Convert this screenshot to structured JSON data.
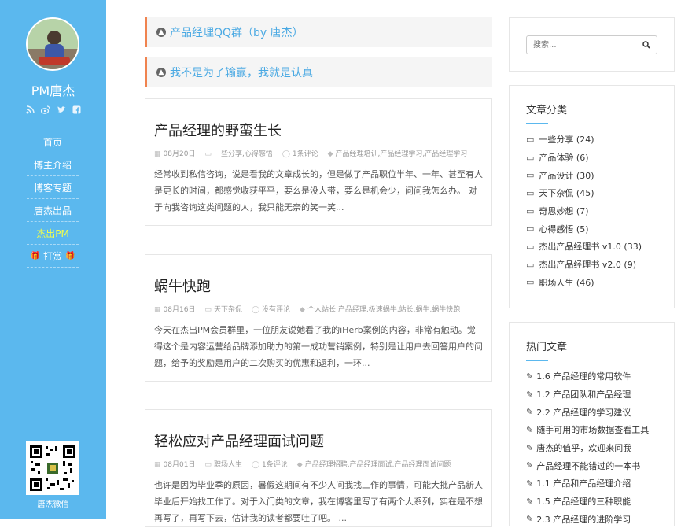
{
  "sidebar": {
    "title": "PM唐杰",
    "social_icons": [
      "rss-icon",
      "weibo-icon",
      "twitter-icon",
      "facebook-icon"
    ],
    "nav": [
      {
        "label": "首页",
        "active": false
      },
      {
        "label": "博主介绍",
        "active": false
      },
      {
        "label": "博客专题",
        "active": false
      },
      {
        "label": "唐杰出品",
        "active": false
      },
      {
        "label": "杰出PM",
        "active": true
      },
      {
        "label": "打赏",
        "active": false
      }
    ],
    "qr_caption": "唐杰微信"
  },
  "notices": [
    {
      "text": "产品经理QQ群（by 唐杰）"
    },
    {
      "text": "我不是为了输赢，我就是认真"
    }
  ],
  "posts": [
    {
      "title": "产品经理的野蛮生长",
      "date": "08月20日",
      "category": "一些分享,心得感悟",
      "comments": "1条评论",
      "tags": "产品经理培训,产品经理学习,产品经理学习",
      "excerpt": "经常收到私信咨询，说是看我的文章成长的，但是做了产品职位半年、一年、甚至有人是更长的时间，都感觉收获平平，要么是没人带，要么是机会少，问问我怎么办。 对于向我咨询这类问题的人，我只能无奈的笑一笑..."
    },
    {
      "title": "蜗牛快跑",
      "date": "08月16日",
      "category": "天下杂侃",
      "comments": "没有评论",
      "tags": "个人站长,产品经理,极速蜗牛,站长,蜗牛,蜗牛快跑",
      "excerpt": "今天在杰出PM会员群里，一位朋友说她看了我的iHerb案例的内容，非常有触动。觉得这个是内容运营给品牌添加助力的第一成功营销案例，特别是让用户去回答用户的问题，给予的奖励是用户的二次购买的优惠和返利，一环..."
    },
    {
      "title": "轻松应对产品经理面试问题",
      "date": "08月01日",
      "category": "职场人生",
      "comments": "1条评论",
      "tags": "产品经理招聘,产品经理面试,产品经理面试问题",
      "excerpt": "也许是因为毕业季的原因，暑假这期间有不少人问我找工作的事情，可能大批产品新人毕业后开始找工作了。对于入门类的文章，我在博客里写了有两个大系列，实在是不想再写了，再写下去，估计我的读者都要吐了吧。 ..."
    }
  ],
  "search": {
    "placeholder": "搜索..."
  },
  "categories_widget": {
    "title": "文章分类",
    "items": [
      "一些分享 (24)",
      "产品体验 (6)",
      "产品设计 (30)",
      "天下杂侃 (45)",
      "奇思妙想 (7)",
      "心得感悟 (5)",
      "杰出产品经理书 v1.0 (33)",
      "杰出产品经理书 v2.0 (9)",
      "职场人生 (46)"
    ]
  },
  "hot_widget": {
    "title": "热门文章",
    "items": [
      "1.6 产品经理的常用软件",
      "1.2 产品团队和产品经理",
      "2.2 产品经理的学习建议",
      "随手可用的市场数据查看工具",
      "唐杰的值乎，欢迎来问我",
      "产品经理不能错过的一本书",
      "1.1 产品和产品经理介绍",
      "1.5 产品经理的三种职能",
      "2.3 产品经理的进阶学习"
    ]
  },
  "colors": {
    "sidebar": "#5bb8ee",
    "accent_border": "#f0834f",
    "link": "#4aa9e3",
    "active_nav": "#f3ff4a"
  }
}
